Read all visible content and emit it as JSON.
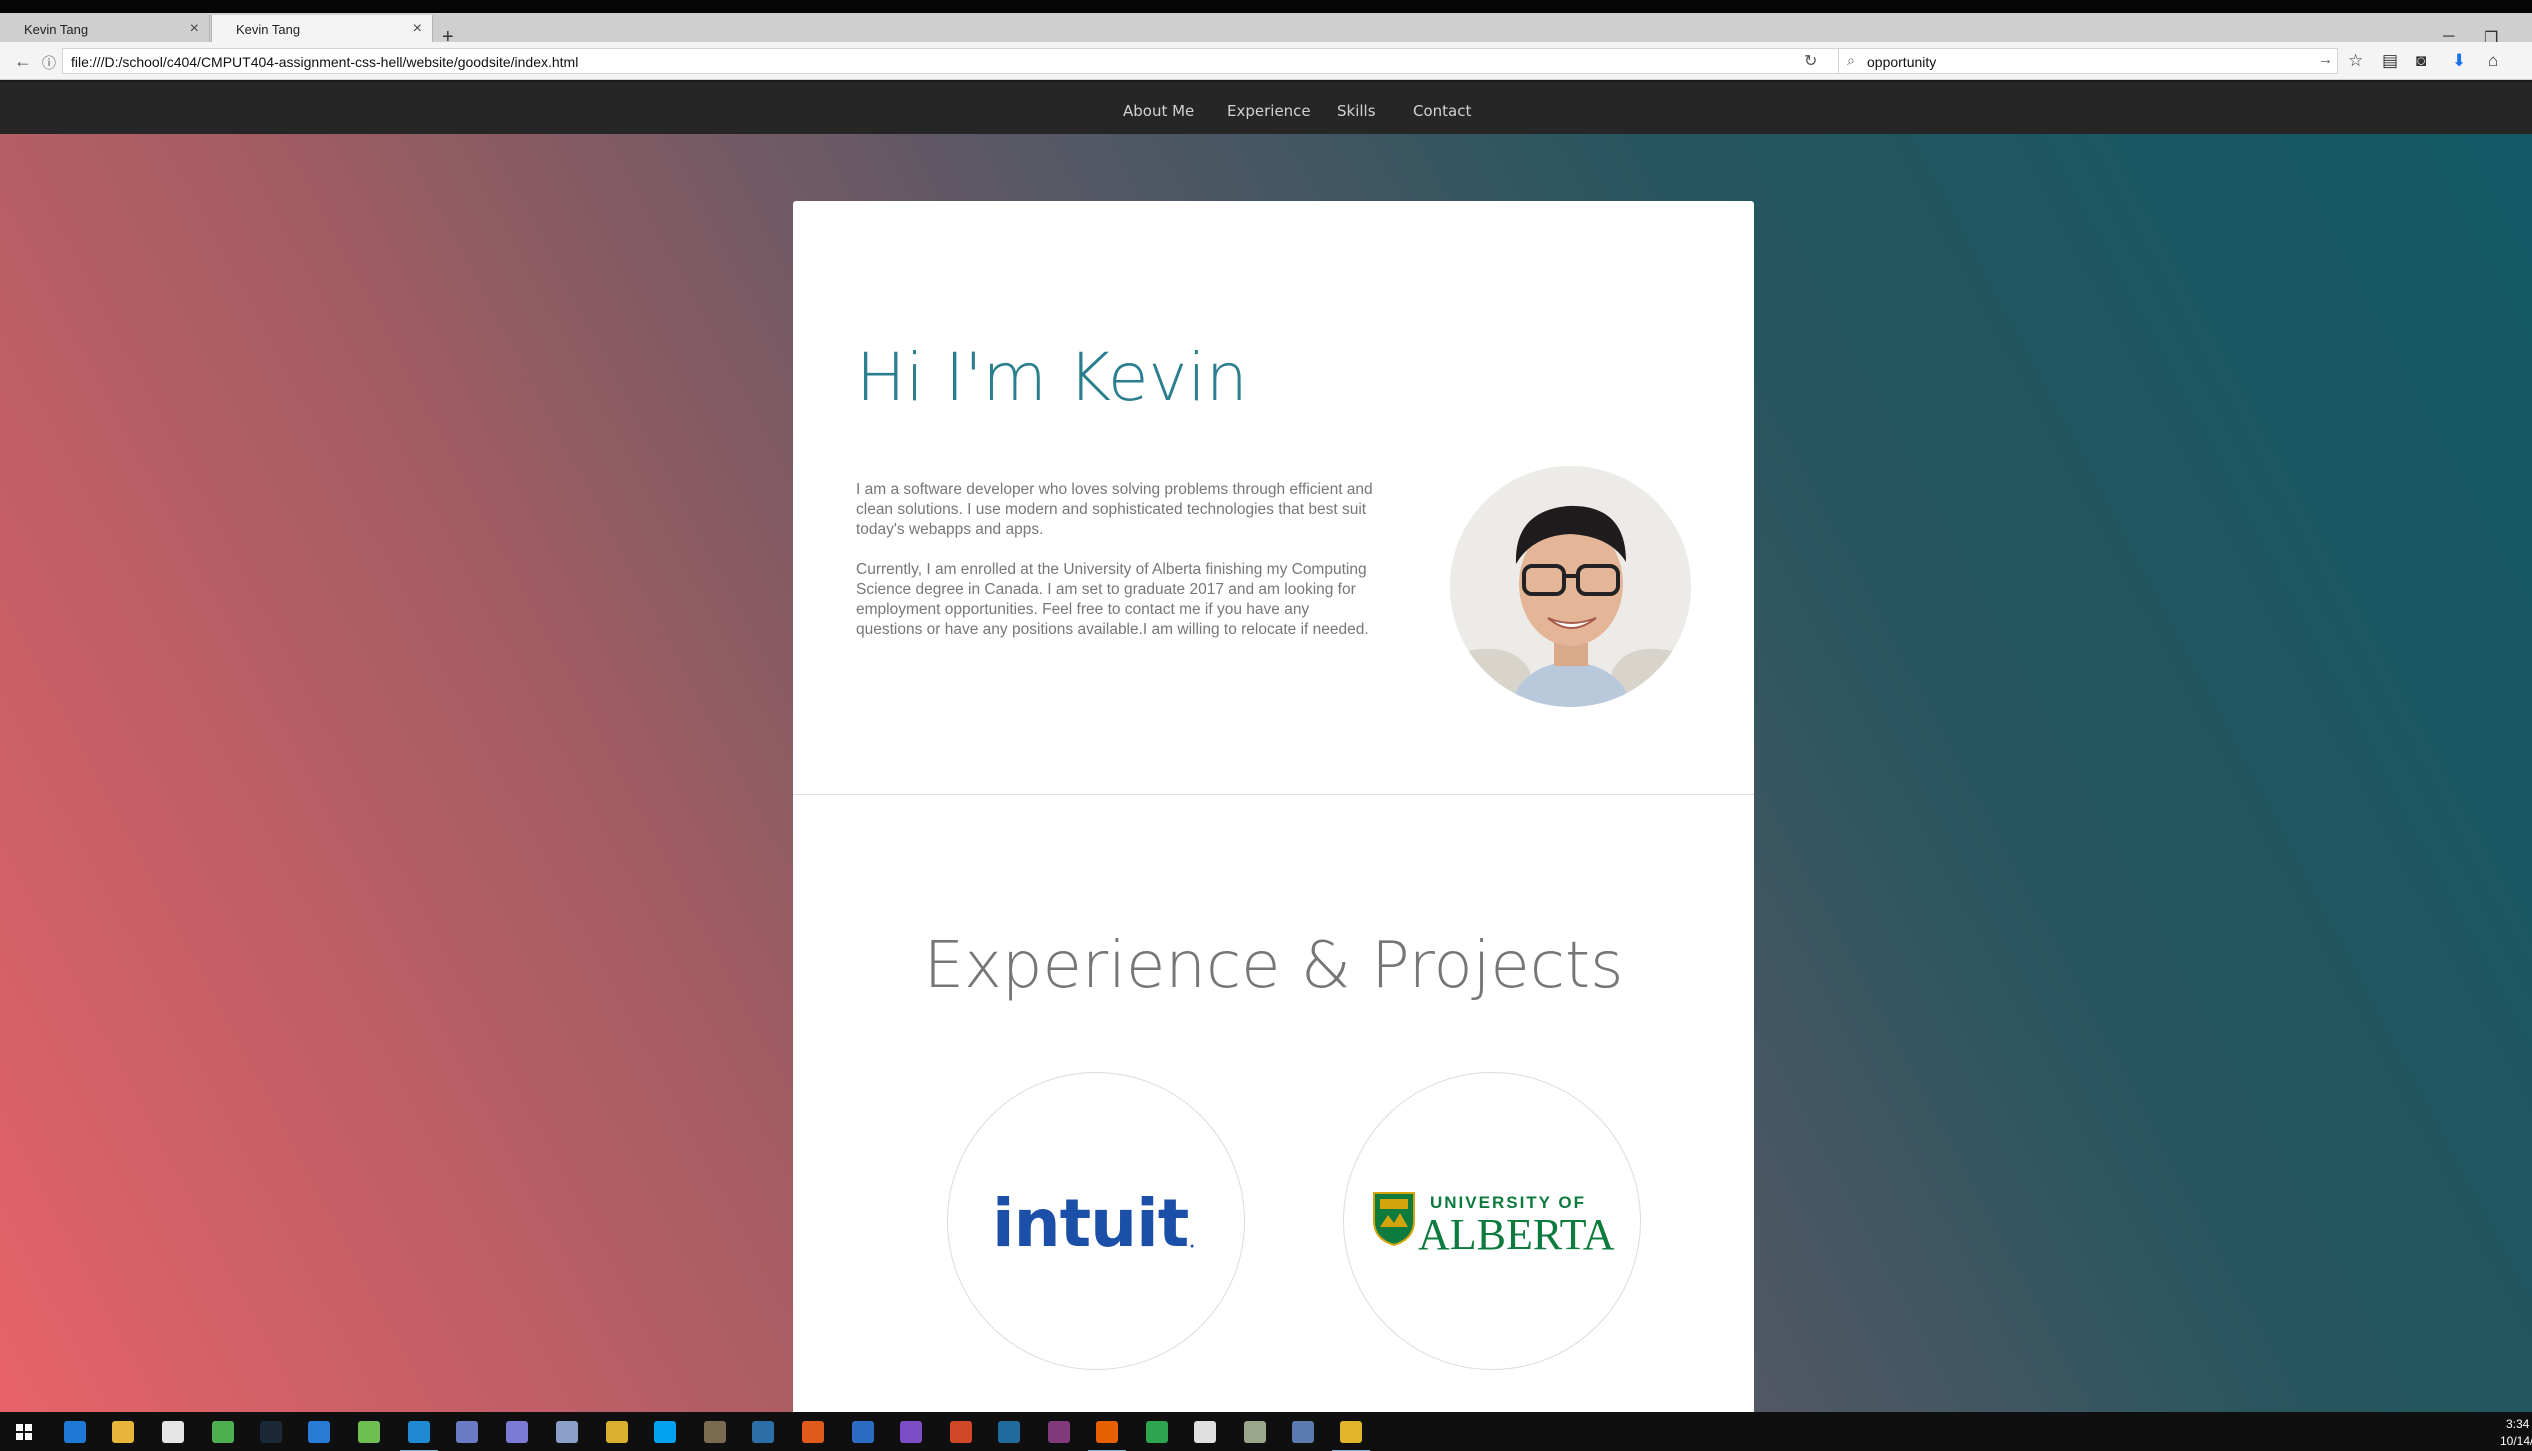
{
  "browser": {
    "tabs": [
      {
        "label": "Kevin Tang",
        "active": false
      },
      {
        "label": "Kevin Tang",
        "active": true
      }
    ],
    "url": "file:///D:/school/c404/CMPUT404-assignment-css-hell/website/goodsite/index.html",
    "search_value": "opportunity",
    "icons": [
      "back-icon",
      "info-icon",
      "reload-icon",
      "search-icon",
      "go-arrow-icon",
      "star-icon",
      "reading-list-icon",
      "pocket-icon",
      "download-icon",
      "home-icon"
    ]
  },
  "site_nav": {
    "links": [
      "About Me",
      "Experience",
      "Skills",
      "Contact"
    ]
  },
  "about": {
    "title": "Hi I'm Kevin",
    "paragraph1": "I am a software developer who loves solving problems through efficient and clean solutions. I use modern and sophisticated technologies that best suit today's webapps and apps.",
    "paragraph2": "Currently, I am enrolled at the University of Alberta finishing my Computing Science degree in Canada. I am set to graduate 2017 and am looking for employment opportunities. Feel free to contact me if you have any questions or have any positions available.I am willing to relocate if needed."
  },
  "experience": {
    "title": "Experience & Projects",
    "logos": [
      {
        "name": "intuit",
        "text": "intuit",
        "color": "#1b4fa8"
      },
      {
        "name": "university-of-alberta",
        "top_text": "UNIVERSITY OF",
        "bottom_text": "ALBERTA",
        "color": "#0d7a3e"
      }
    ]
  },
  "taskbar": {
    "time": "3:34",
    "date": "10/14/"
  },
  "colors": {
    "accent": "#2b7e8e",
    "nav_bg": "#262626",
    "gradient_left": "#e7626a",
    "gradient_right": "#135a66"
  }
}
